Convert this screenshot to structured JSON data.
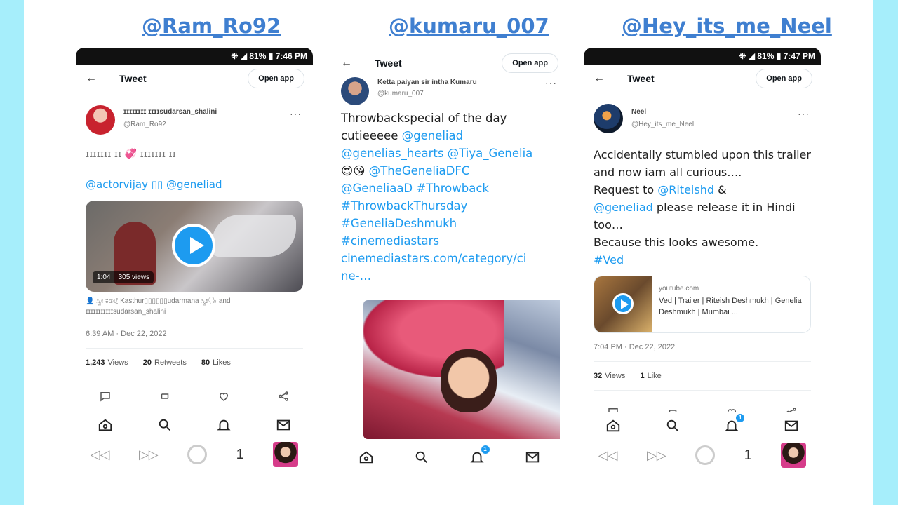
{
  "labels": [
    {
      "handle": "@Ram_Ro92"
    },
    {
      "handle": "@kumaru_007"
    },
    {
      "handle": "@Hey_its_me_Neel"
    }
  ],
  "phones": [
    {
      "status": "⁜ ◢ 81% ▮ 7:46 PM",
      "topbar": {
        "back": "←",
        "title": "Tweet",
        "open_app": "Open app"
      },
      "author": {
        "name": "ɪɪɪɪɪɪɪɪ ɪɪɪɪsudarsan_shalini",
        "handle": "@Ram_Ro92",
        "more": "···"
      },
      "text": "ɪɪɪɪɪɪɪ ɪɪ 💞 ɪɪɪɪɪɪɪ ɪɪ",
      "mentions": "@actorvijay ▯▯ @geneliad",
      "video": {
        "duration": "1:04",
        "views": "305 views"
      },
      "tagged": "👤 ಸ್ವೀ ಕಡಲ್ಗೆ Kasthur▯▯▯▯▯▯udarmana ಸ್ವೀ🗣 and ɪɪɪɪɪɪɪɪɪɪɪsudarsan_shalini",
      "timestamp": "6:39 AM · Dec 22, 2022",
      "stats": [
        {
          "count": "1,243",
          "label": "Views"
        },
        {
          "count": "20",
          "label": "Retweets"
        },
        {
          "count": "80",
          "label": "Likes"
        }
      ],
      "actions": [
        "reply",
        "retweet",
        "like",
        "share"
      ],
      "nav_badge": "",
      "sysnav": {
        "back": "◁◁",
        "forward": "▷▷",
        "page": "1"
      }
    },
    {
      "topbar": {
        "back": "←",
        "title": "Tweet",
        "open_app": "Open app"
      },
      "author": {
        "name": "Ketta paiyan sir intha Kumaru",
        "handle": "@kumaru_007",
        "more": "···"
      },
      "text_plain": "Throwbackspecial of the day cutieeeee ",
      "text_links": [
        "@geneliad",
        "@genelias_hearts @Tiya_Genelia",
        "@TheGeneliaDFC",
        "@GeneliaaD #Throwback",
        "#ThrowbackThursday",
        "#GeneliaDeshmukh",
        "#cinemediastars",
        "cinemediastars.com/category/ci",
        "ne-…"
      ],
      "emoji": "😍😘",
      "nav_badge": "1"
    },
    {
      "status": "⁜ ◢ 81% ▮ 7:47 PM",
      "topbar": {
        "back": "←",
        "title": "Tweet",
        "open_app": "Open app"
      },
      "author": {
        "name": "Neel",
        "handle": "@Hey_its_me_Neel",
        "more": "···"
      },
      "text_1": "Accidentally stumbled upon this trailer and now iam all curious….",
      "text_2": "Request to ",
      "link_1": "@Riteishd",
      "text_3": " &",
      "link_2": "@geneliad",
      "text_4": " please release it in Hindi too…",
      "text_5": "Because this looks awesome.",
      "hashtag": "#Ved",
      "card": {
        "domain": "youtube.com",
        "title": "Ved | Trailer | Riteish Deshmukh | Genelia Deshmukh | Mumbai ..."
      },
      "timestamp": "7:04 PM · Dec 22, 2022",
      "stats": [
        {
          "count": "32",
          "label": "Views"
        },
        {
          "count": "1",
          "label": "Like"
        }
      ],
      "nav_badge": "1",
      "sysnav": {
        "back": "◁◁",
        "forward": "▷▷",
        "page": "1"
      }
    }
  ],
  "colors": {
    "link": "#1d9bf0",
    "handle_label": "#3f7fd0",
    "frame_bg": "#a6eefb"
  }
}
